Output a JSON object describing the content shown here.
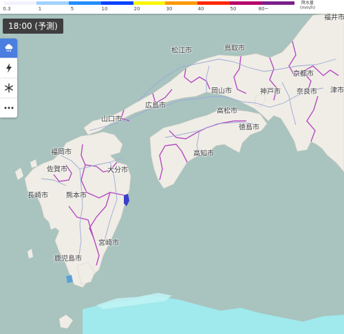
{
  "legend": {
    "ticks": [
      "0.3",
      "1",
      "5",
      "10",
      "20",
      "30",
      "40",
      "50",
      "80~"
    ],
    "unit_lines": [
      "降水量",
      "(mm/h)"
    ],
    "colors": [
      "#f2f2ff",
      "#a0d2ff",
      "#218cff",
      "#0041ff",
      "#faf500",
      "#ff9900",
      "#ff2800",
      "#b40068",
      "#7a1f8a"
    ]
  },
  "time_label": "18:00 (予測)",
  "tools": [
    {
      "icon": "rain-cloud-icon",
      "active": true
    },
    {
      "icon": "lightning-icon",
      "active": false
    },
    {
      "icon": "snowflake-icon",
      "active": false
    },
    {
      "icon": "more-icon",
      "active": false
    }
  ],
  "cities": {
    "fukui": "福井市",
    "matsue": "松江市",
    "tottori": "鳥取市",
    "kyoto": "京都市",
    "tsu": "津市",
    "okayama": "岡山市",
    "kobe": "神戸市",
    "nara": "奈良市",
    "hiroshima": "広島市",
    "takamatsu": "高松市",
    "yamaguchi": "山口市",
    "tokushima": "徳島市",
    "fukuoka": "福岡市",
    "kochi": "高知市",
    "saga": "佐賀市",
    "oita": "大分市",
    "nagasaki": "長崎市",
    "kumamoto": "熊本市",
    "miyazaki": "宮崎市",
    "kagoshima": "鹿児島市"
  },
  "colors": {
    "sea": "#a9c3bf",
    "land": "#f0ede6",
    "boundary": "#b44ac0",
    "road": "#9aa9d6",
    "rain_light": "#9ff0f3",
    "rain_heavy": "#3a3fc8"
  }
}
